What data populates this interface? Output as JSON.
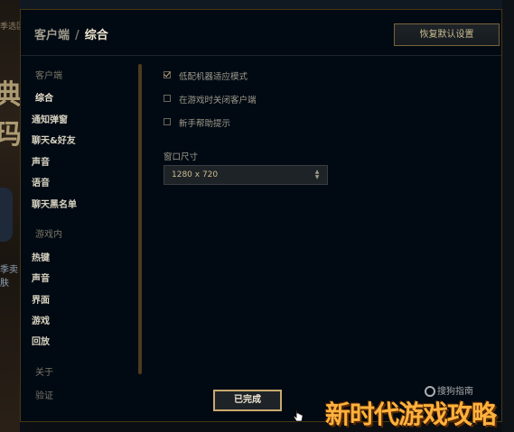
{
  "background": {
    "left_texts": [
      "季选区",
      "典玛",
      "季卖肤"
    ]
  },
  "header": {
    "breadcrumb_parent": "客户端",
    "breadcrumb_sep": "/",
    "breadcrumb_current": "综合",
    "restore_label": "恢复默认设置"
  },
  "sidebar": {
    "sections": [
      {
        "label": "客户端"
      },
      {
        "label": "游戏内"
      },
      {
        "label": "关于"
      }
    ],
    "client_items": [
      {
        "label": "综合",
        "active": true
      },
      {
        "label": "通知弹窗"
      },
      {
        "label": "聊天&好友"
      },
      {
        "label": "声音"
      },
      {
        "label": "语音"
      },
      {
        "label": "聊天黑名单"
      }
    ],
    "ingame_items": [
      {
        "label": "热键"
      },
      {
        "label": "声音"
      },
      {
        "label": "界面"
      },
      {
        "label": "游戏"
      },
      {
        "label": "回放"
      }
    ],
    "about_items": [
      {
        "label": "验证"
      }
    ]
  },
  "content": {
    "checkboxes": [
      {
        "label": "低配机器适应模式",
        "checked": true
      },
      {
        "label": "在游戏时关闭客户端",
        "checked": false
      },
      {
        "label": "新手帮助提示",
        "checked": false
      }
    ],
    "window_size_label": "窗口尺寸",
    "window_size_value": "1280 x 720"
  },
  "footer": {
    "done_label": "已完成"
  },
  "watermark": {
    "logo_text": "搜狗指南",
    "big_text": "新时代游戏攻略"
  },
  "colors": {
    "accent_gold": "#c8aa6e",
    "panel_bg": "#010a13",
    "border_gold": "#463714"
  }
}
